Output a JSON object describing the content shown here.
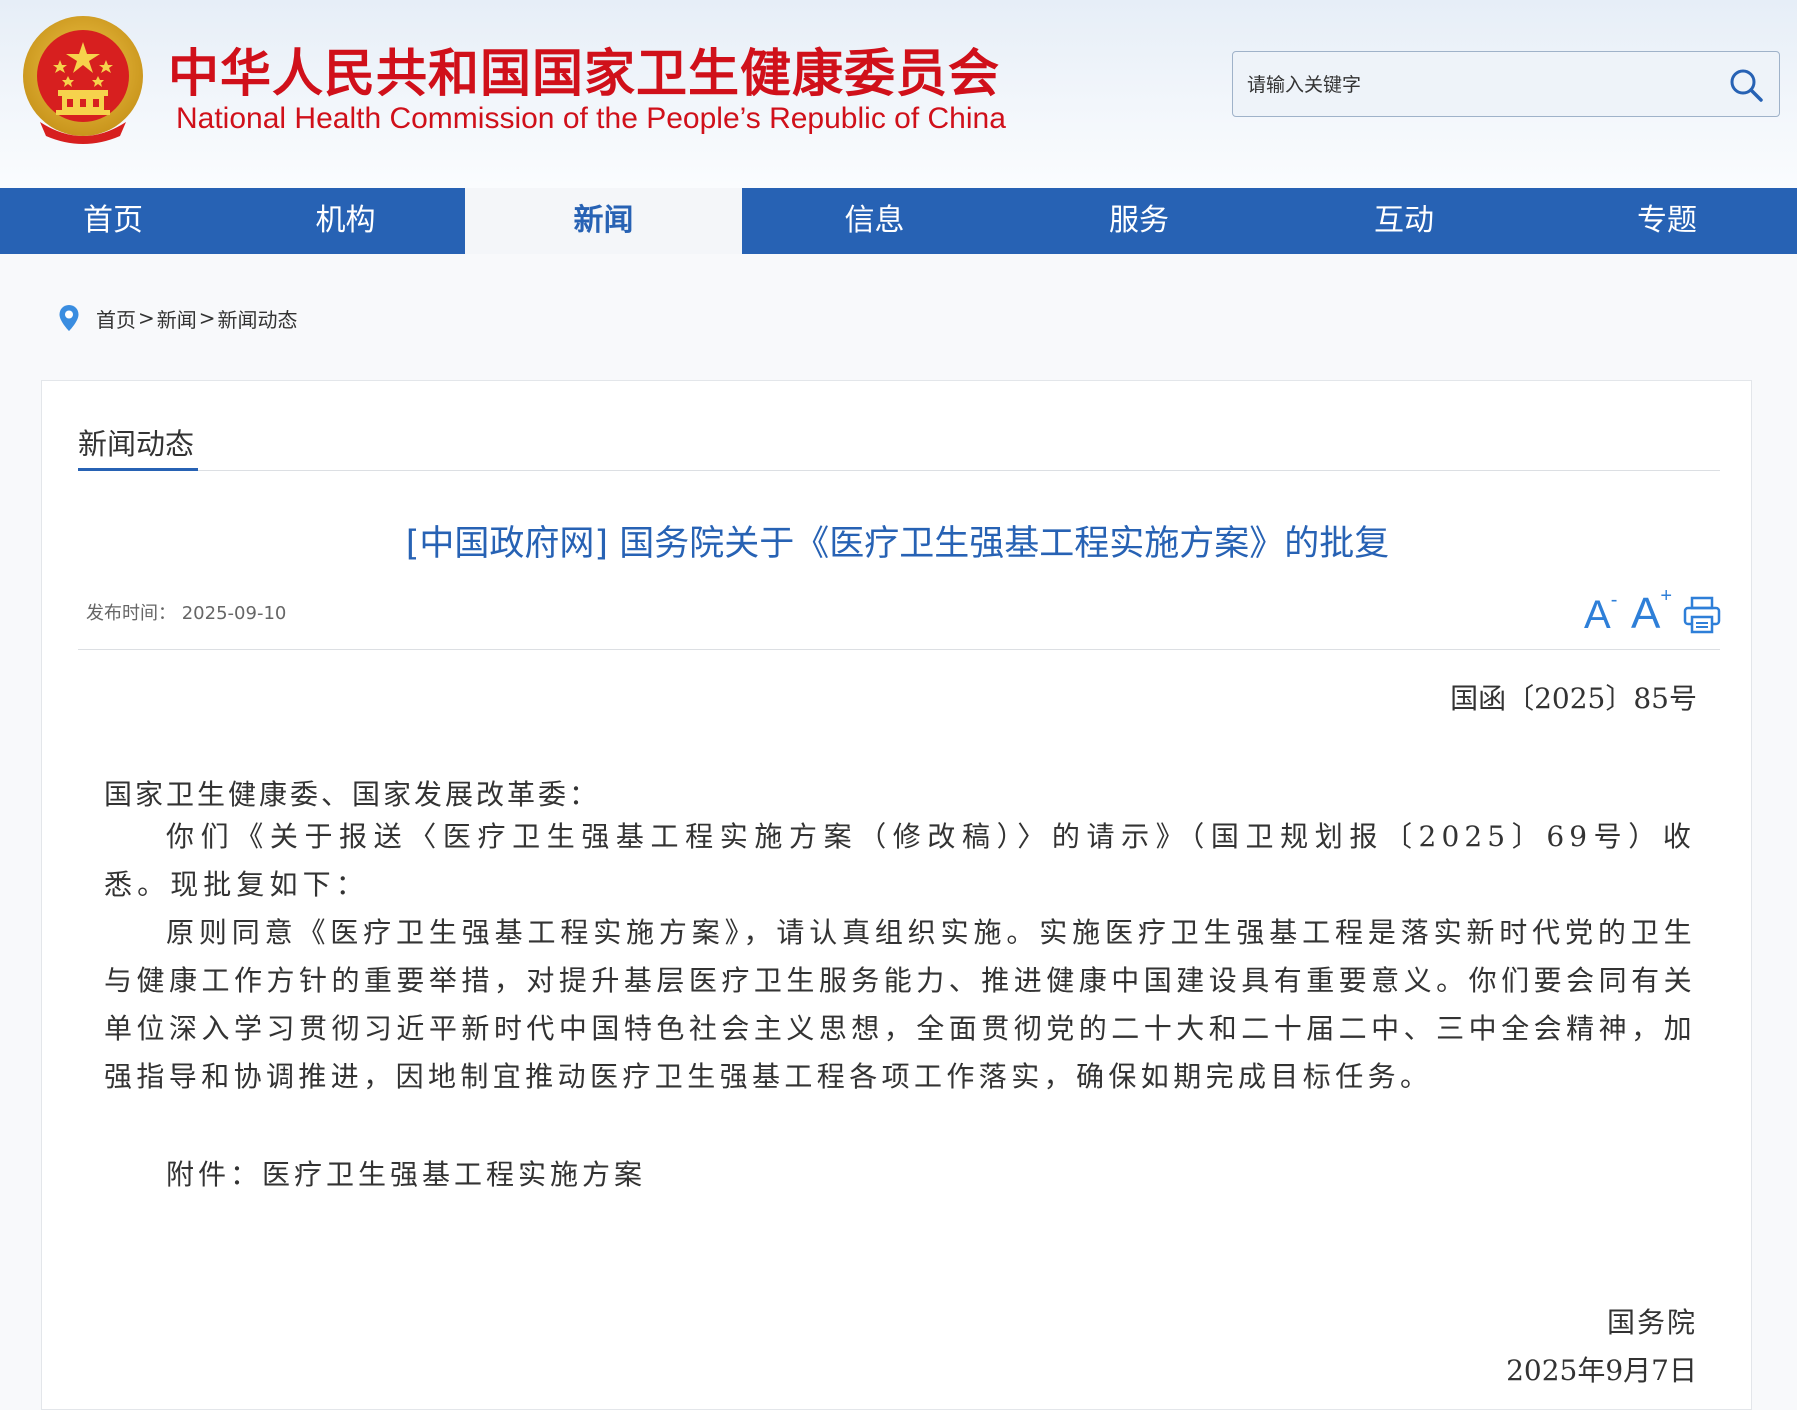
{
  "header": {
    "title_cn": "中华人民共和国国家卫生健康委员会",
    "title_en": "National Health Commission of the People’s  Republic of China",
    "search_placeholder": "请输入关键字",
    "colors": {
      "brand_red": "#d0101a",
      "nav_blue": "#2762b4"
    }
  },
  "nav": {
    "items": [
      {
        "label": "首页",
        "active": false
      },
      {
        "label": "机构",
        "active": false
      },
      {
        "label": "新闻",
        "active": true
      },
      {
        "label": "信息",
        "active": false
      },
      {
        "label": "服务",
        "active": false
      },
      {
        "label": "互动",
        "active": false
      },
      {
        "label": "专题",
        "active": false
      }
    ]
  },
  "breadcrumb": {
    "icon": "location-pin-icon",
    "items": [
      "首页",
      "新闻",
      "新闻动态"
    ],
    "separator": ">"
  },
  "section": {
    "title": "新闻动态"
  },
  "article": {
    "title": "[中国政府网] 国务院关于《医疗卫生强基工程实施方案》的批复",
    "publish_label": "发布时间：",
    "publish_date": "2025-09-10",
    "tools": {
      "decrease_font": "A",
      "decrease_font_sup": "-",
      "increase_font": "A",
      "increase_font_sup": "+",
      "print_icon": "print-icon"
    },
    "doc_number": "国函〔2025〕85号",
    "addressee": "国家卫生健康委、国家发展改革委：",
    "paragraphs": [
      "你们《关于报送〈医疗卫生强基工程实施方案（修改稿）〉的请示》（国卫规划报〔2025〕69号）收悉。现批复如下：",
      "原则同意《医疗卫生强基工程实施方案》，请认真组织实施。实施医疗卫生强基工程是落实新时代党的卫生与健康工作方针的重要举措，对提升基层医疗卫生服务能力、推进健康中国建设具有重要意义。你们要会同有关单位深入学习贯彻习近平新时代中国特色社会主义思想，全面贯彻党的二十大和二十届二中、三中全会精神，加强指导和协调推进，因地制宜推动医疗卫生强基工程各项工作落实，确保如期完成目标任务。"
    ],
    "attachment": "附件：医疗卫生强基工程实施方案",
    "signer": "国务院",
    "sign_date": "2025年9月7日"
  }
}
